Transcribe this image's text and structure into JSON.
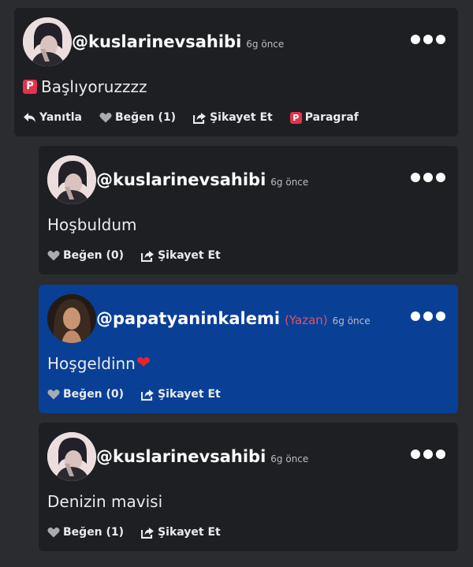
{
  "comments": [
    {
      "username": "@kuslarinevsahibi",
      "time": "6g önce",
      "text": "Başlıyoruzzzz",
      "actions": {
        "reply": "Yanıtla",
        "like": "Beğen (1)",
        "report": "Şikayet Et",
        "paragraph": "Paragraf"
      }
    },
    {
      "username": "@kuslarinevsahibi",
      "time": "6g önce",
      "text": "Hoşbuldum",
      "actions": {
        "like": "Beğen (0)",
        "report": "Şikayet Et"
      }
    },
    {
      "username": "@papatyaninkalemi",
      "author_badge": "(Yazan)",
      "time": "6g önce",
      "text": "Hoşgeldinn",
      "emoji": "❤",
      "actions": {
        "like": "Beğen (0)",
        "report": "Şikayet Et"
      }
    },
    {
      "username": "@kuslarinevsahibi",
      "time": "6g önce",
      "text": "Denizin mavisi",
      "actions": {
        "like": "Beğen (1)",
        "report": "Şikayet Et"
      }
    }
  ],
  "icons": {
    "more": "more-options-icon",
    "reply": "reply-arrow-icon",
    "like": "heart-icon",
    "report": "share-report-icon",
    "paragraph": "paragraph-p-icon"
  },
  "colors": {
    "page_bg": "#2a2c30",
    "card_bg": "#1d1f23",
    "author_card_bg": "#0a3f96",
    "author_badge": "#e0506a",
    "paragraph_badge": "#e0344d"
  }
}
